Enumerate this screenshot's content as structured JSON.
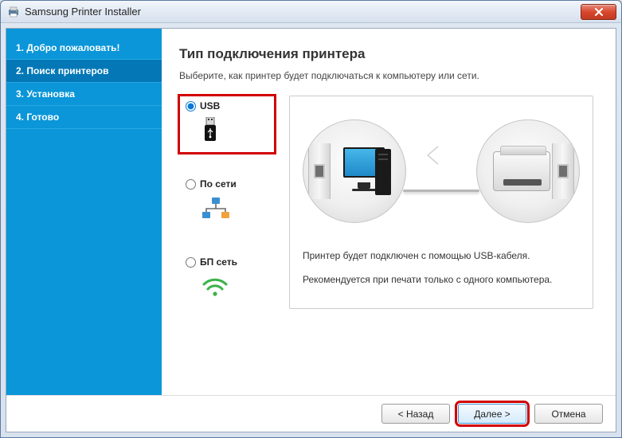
{
  "window": {
    "title": "Samsung Printer Installer"
  },
  "sidebar": {
    "steps": [
      "1. Добро пожаловать!",
      "2. Поиск принтеров",
      "3. Установка",
      "4. Готово"
    ],
    "active_index": 1
  },
  "main": {
    "heading": "Тип подключения принтера",
    "subtitle": "Выберите, как принтер будет подключаться к компьютеру или сети."
  },
  "options": {
    "usb": {
      "label": "USB",
      "selected": true
    },
    "network": {
      "label": "По сети",
      "selected": false
    },
    "wireless": {
      "label": "БП сеть",
      "selected": false
    }
  },
  "info": {
    "line1": "Принтер будет подключен с помощью USB-кабеля.",
    "line2": "Рекомендуется при печати только с одного компьютера."
  },
  "footer": {
    "back": "< Назад",
    "next": "Далее >",
    "cancel": "Отмена"
  }
}
